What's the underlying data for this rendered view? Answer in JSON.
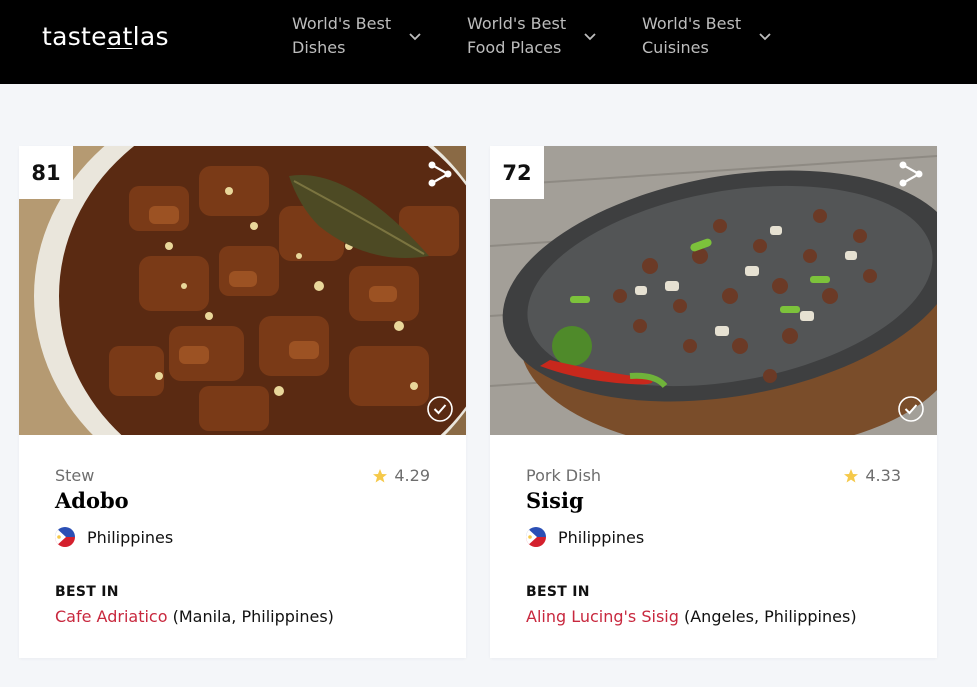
{
  "brand": {
    "logo_prefix": "taste",
    "logo_mid": "at",
    "logo_suffix": "las"
  },
  "nav": [
    {
      "label": "World's Best Dishes"
    },
    {
      "label": "World's Best Food Places"
    },
    {
      "label": "World's Best Cuisines"
    }
  ],
  "colors": {
    "accent": "#c8283e",
    "topbar": "#000000",
    "background": "#f4f6f9",
    "star": "#f5c94a"
  },
  "cards": [
    {
      "rank": "81",
      "type": "Stew",
      "rating": "4.29",
      "name": "Adobo",
      "country": "Philippines",
      "best_in_label": "BEST IN",
      "place_name": "Cafe Adriatico",
      "place_location": "(Manila, Philippines)",
      "icons": [
        "share-icon",
        "check-circle-icon",
        "star-icon",
        "philippines-flag-icon"
      ]
    },
    {
      "rank": "72",
      "type": "Pork Dish",
      "rating": "4.33",
      "name": "Sisig",
      "country": "Philippines",
      "best_in_label": "BEST IN",
      "place_name": "Aling Lucing's Sisig",
      "place_location": "(Angeles, Philippines)",
      "icons": [
        "share-icon",
        "check-circle-icon",
        "star-icon",
        "philippines-flag-icon"
      ]
    }
  ]
}
